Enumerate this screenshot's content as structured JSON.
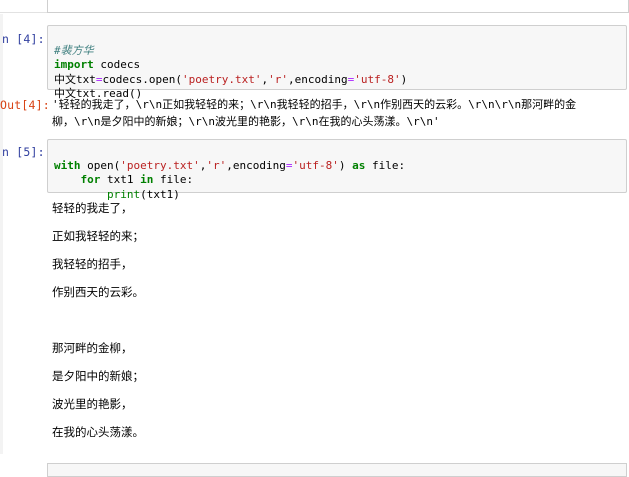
{
  "cells": [
    {
      "in_prompt": "n  [4]:",
      "code_lines": [
        {
          "comment": "#裴方华"
        },
        {
          "kw": "import",
          "rest": " codecs"
        },
        {
          "a": "中文txt",
          "op": "=",
          "b": "codecs.open(",
          "s1": "'poetry.txt'",
          "c": ",",
          "s2": "'r'",
          "d": ",encoding",
          "op2": "=",
          "s3": "'utf-8'",
          "e": ")"
        },
        {
          "plain": "中文txt.read()"
        }
      ],
      "out_prompt": "Out[4]:",
      "output_lines": [
        "'轻轻的我走了，\\r\\n正如我轻轻的来；\\r\\n我轻轻的招手，\\r\\n作别西天的云彩。\\r\\n\\r\\n那河畔的金",
        "柳，\\r\\n是夕阳中的新娘；\\r\\n波光里的艳影，\\r\\n在我的心头荡漾。\\r\\n'"
      ]
    },
    {
      "in_prompt": "n  [5]:",
      "code_lines": [
        {
          "kw": "with",
          "b": " open(",
          "s1": "'poetry.txt'",
          "c": ",",
          "s2": "'r'",
          "d": ",encoding",
          "op2": "=",
          "s3": "'utf-8'",
          "e": ") ",
          "kw2": "as",
          "f": " file:"
        },
        {
          "indent": "    ",
          "kw": "for",
          "b": " txt1 ",
          "kw2": "in",
          "f": " file:"
        },
        {
          "indent": "        ",
          "bi": "print",
          "e": "(txt1)"
        }
      ],
      "print_output": [
        "轻轻的我走了，",
        "正如我轻轻的来；",
        "我轻轻的招手，",
        "作别西天的云彩。",
        "",
        "那河畔的金柳，",
        "是夕阳中的新娘；",
        "波光里的艳影，",
        "在我的心头荡漾。"
      ]
    }
  ]
}
